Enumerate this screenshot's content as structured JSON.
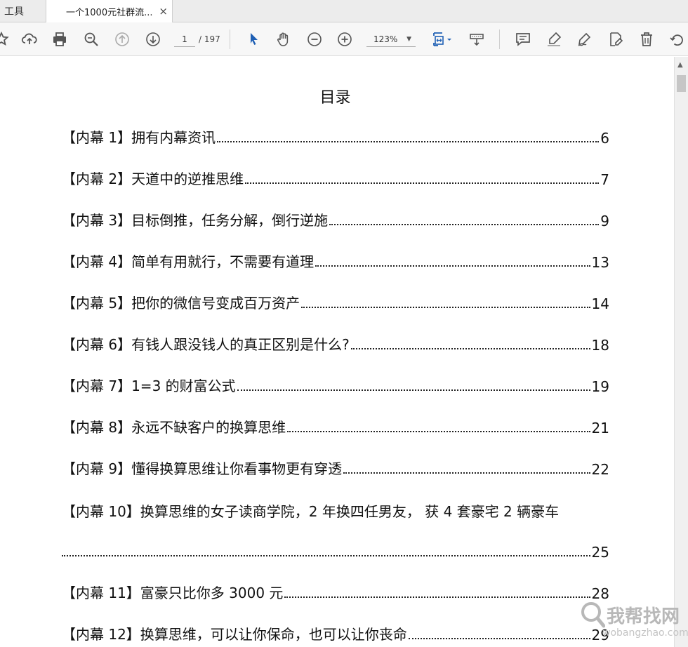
{
  "tabs": {
    "tools_label": "工具",
    "doc_label": "一个1000元社群流...",
    "close_glyph": "×"
  },
  "toolbar": {
    "page_current": "1",
    "page_total": "/ 197",
    "zoom": "123%",
    "zoom_caret": "▼",
    "icons": [
      "star-icon",
      "upload-icon",
      "print-icon",
      "zoom-out-search-icon",
      "prev-page-icon",
      "next-page-icon",
      "select-cursor-icon",
      "hand-tool-icon",
      "zoom-minus-icon",
      "zoom-plus-icon",
      "fit-page-icon",
      "scroll-mode-icon",
      "comment-icon",
      "highlight-icon",
      "sign-icon",
      "edit-icon",
      "delete-icon",
      "rotate-icon"
    ],
    "accent": "#1e5fb4"
  },
  "document": {
    "title": "目录",
    "entries": [
      {
        "text": "【内幕 1】拥有内幕资讯",
        "page": "6"
      },
      {
        "text": "【内幕 2】天道中的逆推思维",
        "page": "7"
      },
      {
        "text": "【内幕 3】目标倒推，任务分解，倒行逆施",
        "page": "9"
      },
      {
        "text": "【内幕 4】简单有用就行，不需要有道理",
        "page": "13"
      },
      {
        "text": "【内幕 5】把你的微信号变成百万资产",
        "page": "14"
      },
      {
        "text": "【内幕 6】有钱人跟没钱人的真正区别是什么?",
        "page": "18"
      },
      {
        "text": "【内幕 7】1=3 的财富公式",
        "page": "19"
      },
      {
        "text": "【内幕 8】永远不缺客户的换算思维",
        "page": "21"
      },
      {
        "text": "【内幕 9】懂得换算思维让你看事物更有穿透",
        "page": "22"
      },
      {
        "text": "【内幕 10】换算思维的女子读商学院，2 年换四任男友，  获 4 套豪宅 2 辆豪车",
        "page": "25"
      },
      {
        "text": "【内幕 11】富豪只比你多 3000 元",
        "page": "28"
      },
      {
        "text": "【内幕 12】换算思维，可以让你保命，也可以让你丧命",
        "page": "29"
      }
    ]
  },
  "watermark": {
    "brand": "我帮找网",
    "url": "wobangzhao.com"
  }
}
